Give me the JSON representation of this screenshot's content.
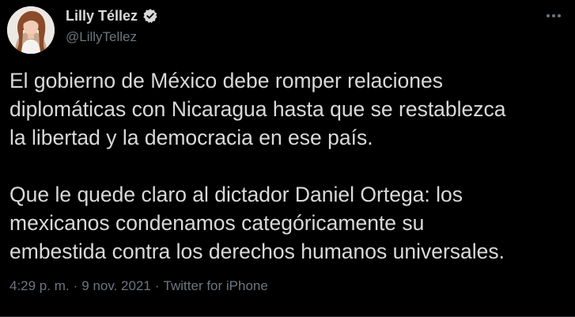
{
  "author": {
    "display_name": "Lilly Téllez",
    "handle": "@LillyTellez",
    "verified_icon": "verified-badge-icon"
  },
  "tweet": {
    "paragraph_1": "El gobierno de México debe romper relaciones\ndiplomáticas con Nicaragua hasta que se restablezca\nla libertad y la democracia en ese país.",
    "paragraph_2": "Que le quede claro al dictador Daniel Ortega: los\nmexicanos condenamos categóricamente su\nembestida contra los derechos humanos universales."
  },
  "meta": {
    "time": "4:29 p. m.",
    "separator": "·",
    "date": "9 nov. 2021",
    "source": "Twitter for iPhone"
  },
  "colors": {
    "background": "#000000",
    "text": "#d9d9d9",
    "muted": "#6e767d"
  }
}
